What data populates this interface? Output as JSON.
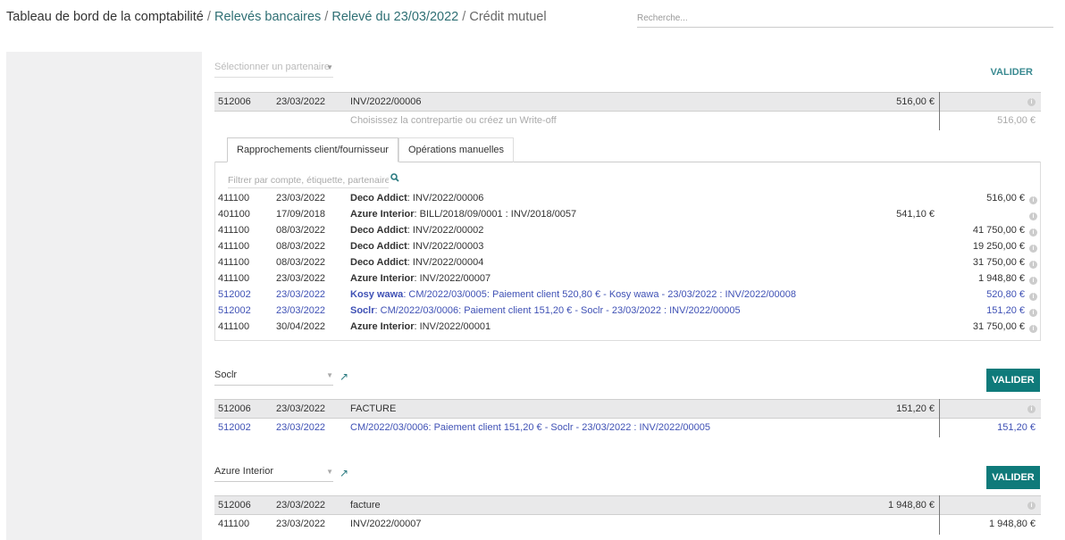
{
  "breadcrumb": {
    "root": "Tableau de bord de la comptabilité",
    "level1": "Relevés bancaires",
    "level2": "Relevé du 23/03/2022",
    "current": "Crédit mutuel",
    "separator": " / "
  },
  "search": {
    "placeholder": "Recherche..."
  },
  "top_line": {
    "partner_placeholder": "Sélectionner un partenaire",
    "validate_link": "VALIDER",
    "statement": {
      "account": "512006",
      "date": "23/03/2022",
      "label": "INV/2022/00006",
      "amount": "516,00 €"
    },
    "hint": "Choisissez la contrepartie ou créez un Write-off",
    "hint_amount": "516,00 €"
  },
  "tabs": [
    {
      "label": "Rapprochements client/fournisseur",
      "active": true
    },
    {
      "label": "Opérations manuelles",
      "active": false
    }
  ],
  "filter": {
    "placeholder": "Filtrer par compte, étiquette, partenaire, m"
  },
  "propositions": [
    {
      "account": "411100",
      "date": "23/03/2022",
      "partner": "Deco Addict",
      "ref": ": INV/2022/00006",
      "debit": "",
      "credit": "516,00 €",
      "blue": false
    },
    {
      "account": "401100",
      "date": "17/09/2018",
      "partner": "Azure Interior",
      "ref": ": BILL/2018/09/0001 : INV/2018/0057",
      "debit": "541,10 €",
      "credit": "",
      "blue": false
    },
    {
      "account": "411100",
      "date": "08/03/2022",
      "partner": "Deco Addict",
      "ref": ": INV/2022/00002",
      "debit": "",
      "credit": "41 750,00 €",
      "blue": false
    },
    {
      "account": "411100",
      "date": "08/03/2022",
      "partner": "Deco Addict",
      "ref": ": INV/2022/00003",
      "debit": "",
      "credit": "19 250,00 €",
      "blue": false
    },
    {
      "account": "411100",
      "date": "08/03/2022",
      "partner": "Deco Addict",
      "ref": ": INV/2022/00004",
      "debit": "",
      "credit": "31 750,00 €",
      "blue": false
    },
    {
      "account": "411100",
      "date": "23/03/2022",
      "partner": "Azure Interior",
      "ref": ": INV/2022/00007",
      "debit": "",
      "credit": "1 948,80 €",
      "blue": false
    },
    {
      "account": "512002",
      "date": "23/03/2022",
      "partner": "Kosy wawa",
      "ref": ": CM/2022/03/0005: Paiement client 520,80 € - Kosy wawa - 23/03/2022 : INV/2022/00008",
      "debit": "",
      "credit": "520,80 €",
      "blue": true
    },
    {
      "account": "512002",
      "date": "23/03/2022",
      "partner": "Soclr",
      "ref": ": CM/2022/03/0006: Paiement client 151,20 € - Soclr - 23/03/2022 : INV/2022/00005",
      "debit": "",
      "credit": "151,20 €",
      "blue": true
    },
    {
      "account": "411100",
      "date": "30/04/2022",
      "partner": "Azure Interior",
      "ref": ": INV/2022/00001",
      "debit": "",
      "credit": "31 750,00 €",
      "blue": false
    }
  ],
  "block2": {
    "partner": "Soclr",
    "validate": "VALIDER",
    "statement": {
      "account": "512006",
      "date": "23/03/2022",
      "label": "FACTURE",
      "amount": "151,20 €"
    },
    "matched": {
      "account": "512002",
      "date": "23/03/2022",
      "label": "CM/2022/03/0006: Paiement client 151,20 € - Soclr - 23/03/2022 : INV/2022/00005",
      "amount": "151,20 €"
    }
  },
  "block3": {
    "partner": "Azure Interior",
    "validate": "VALIDER",
    "statement": {
      "account": "512006",
      "date": "23/03/2022",
      "label": "facture",
      "amount": "1 948,80 €"
    },
    "matched": {
      "account": "411100",
      "date": "23/03/2022",
      "label": "INV/2022/00007",
      "amount": "1 948,80 €"
    }
  },
  "colors": {
    "accent": "#0f7a7a",
    "link": "#2e6f74",
    "blue_text": "#3f51b5",
    "left_panel": "#f0f0f1"
  },
  "icons": {
    "info": "info-icon",
    "search": "search-icon",
    "external": "external-link-icon",
    "caret": "caret-down-icon"
  }
}
